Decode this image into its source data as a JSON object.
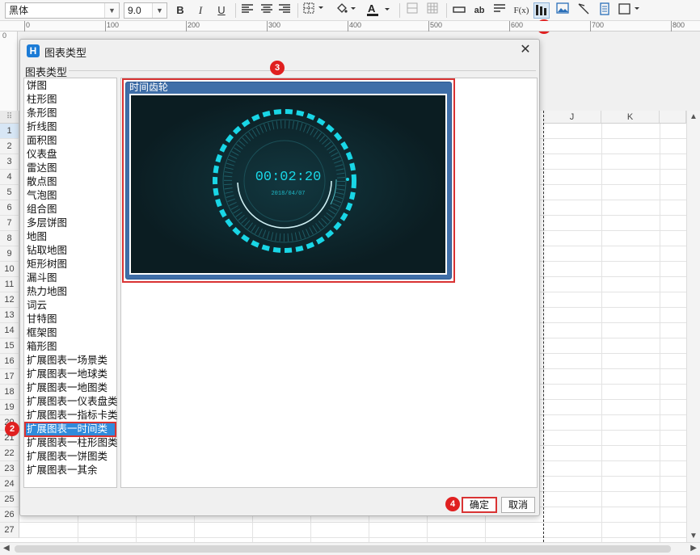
{
  "toolbar": {
    "font_name": "黑体",
    "font_size": "9.0",
    "bold": "B",
    "italic": "I",
    "underline": "U",
    "text_style_ab": "ab",
    "formula": "F(x)"
  },
  "ruler": {
    "labels": [
      "0",
      "100",
      "200",
      "300",
      "400",
      "500",
      "600",
      "700",
      "800"
    ]
  },
  "vruler": {
    "label": "0"
  },
  "sheet": {
    "columns": [
      "J",
      "K"
    ],
    "rows": [
      "1",
      "2",
      "3",
      "4",
      "5",
      "6",
      "7",
      "8",
      "9",
      "10",
      "11",
      "12",
      "13",
      "14",
      "15",
      "16",
      "17",
      "18",
      "19",
      "20",
      "21",
      "22",
      "23",
      "24",
      "25",
      "26",
      "27"
    ]
  },
  "dialog": {
    "title": "图表类型",
    "group_label": "图表类型",
    "chart_types": [
      "饼图",
      "柱形图",
      "条形图",
      "折线图",
      "面积图",
      "仪表盘",
      "雷达图",
      "散点图",
      "气泡图",
      "组合图",
      "多层饼图",
      "地图",
      "钻取地图",
      "矩形树图",
      "漏斗图",
      "热力地图",
      "词云",
      "甘特图",
      "框架图",
      "箱形图",
      "扩展图表一场景类",
      "扩展图表一地球类",
      "扩展图表一地图类",
      "扩展图表一仪表盘类",
      "扩展图表一指标卡类",
      "扩展图表一时间类",
      "扩展图表一柱形图类",
      "扩展图表一饼图类",
      "扩展图表一其余"
    ],
    "selected_index": 25,
    "preview": {
      "title": "时间齿轮",
      "clock_time": "00:02:20",
      "clock_date": "2018/04/07"
    },
    "ok_label": "确定",
    "cancel_label": "取消"
  },
  "annotations": [
    "1",
    "2",
    "3",
    "4"
  ],
  "colors": {
    "accent_red": "#d93333",
    "selection_blue": "#2f8bdc",
    "clock_cyan": "#19d6e6",
    "clock_bg": "#0b1d22"
  }
}
